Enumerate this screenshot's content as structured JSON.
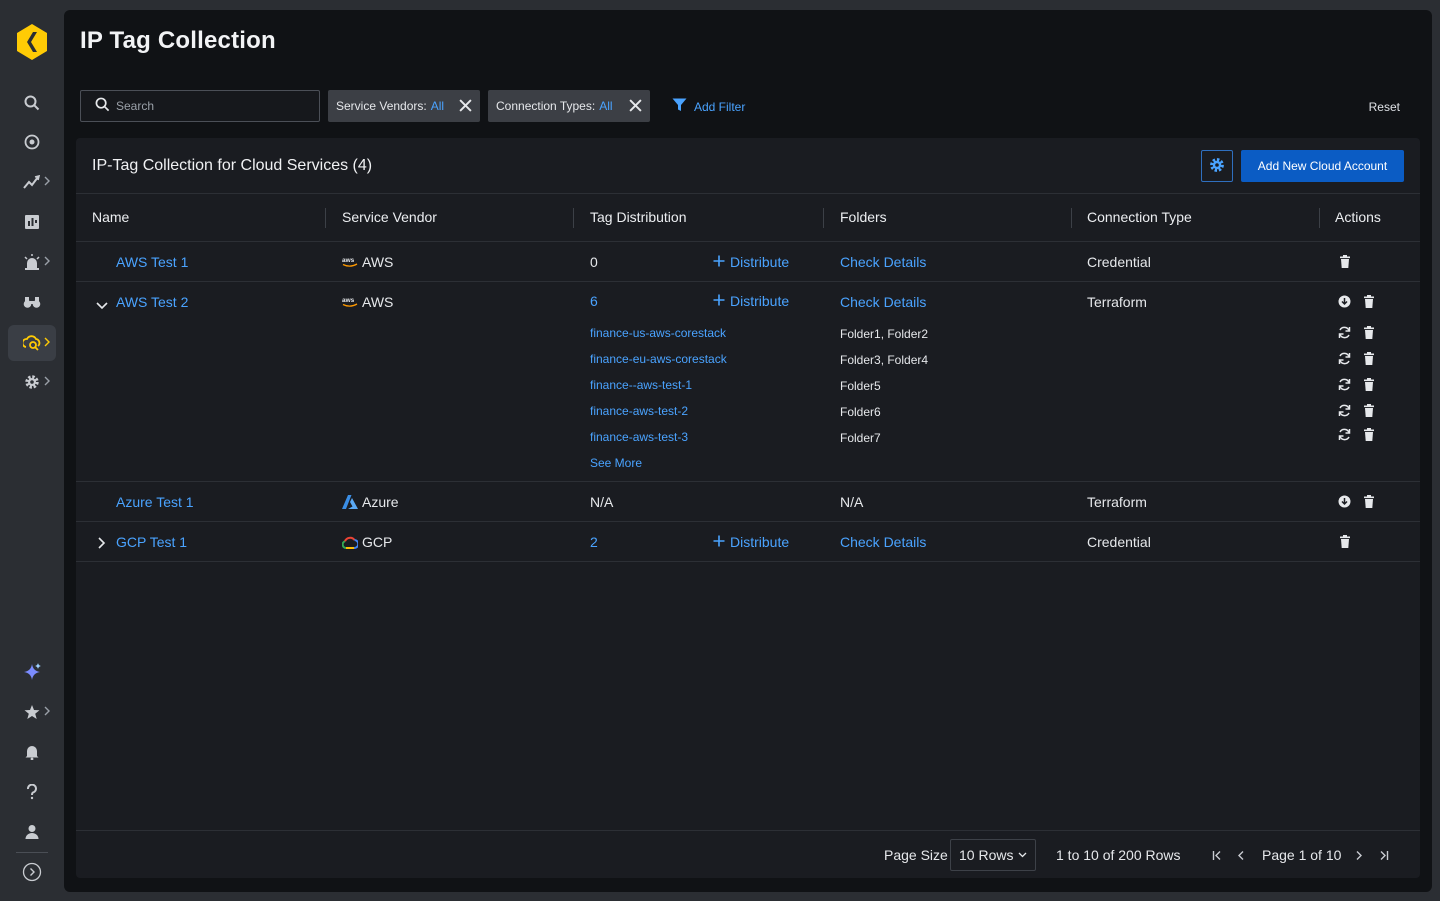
{
  "page": {
    "title": "IP Tag Collection"
  },
  "filters": {
    "search_placeholder": "Search",
    "chips": [
      {
        "label": "Service Vendors:",
        "value": "All"
      },
      {
        "label": "Connection Types:",
        "value": "All"
      }
    ],
    "add_filter_label": "Add Filter",
    "reset_label": "Reset"
  },
  "card": {
    "title": "IP-Tag Collection for Cloud Services (4)",
    "add_button_label": "Add New Cloud Account"
  },
  "columns": [
    "Name",
    "Service Vendor",
    "Tag Distribution",
    "Folders",
    "Connection Type",
    "Actions"
  ],
  "rows": [
    {
      "name": "AWS Test 1",
      "vendor": "AWS",
      "vendor_icon": "aws-logo-icon",
      "tag_count": "0",
      "distribute_label": "Distribute",
      "folders": "Check Details",
      "connection_type": "Credential"
    },
    {
      "name": "AWS Test 2",
      "vendor": "AWS",
      "vendor_icon": "aws-logo-icon",
      "tag_count": "6",
      "distribute_label": "Distribute",
      "folders": "Check Details",
      "connection_type": "Terraform",
      "sub_items": [
        {
          "tag": "finance-us-aws-corestack",
          "folders": "Folder1, Folder2"
        },
        {
          "tag": "finance-eu-aws-corestack",
          "folders": "Folder3, Folder4"
        },
        {
          "tag": "finance--aws-test-1",
          "folders": "Folder5"
        },
        {
          "tag": "finance-aws-test-2",
          "folders": "Folder6"
        },
        {
          "tag": "finance-aws-test-3",
          "folders": "Folder7"
        }
      ],
      "see_more_label": "See More"
    },
    {
      "name": "Azure Test 1",
      "vendor": "Azure",
      "vendor_icon": "azure-logo-icon",
      "tag_count": "N/A",
      "folders": "N/A",
      "connection_type": "Terraform"
    },
    {
      "name": "GCP Test 1",
      "vendor": "GCP",
      "vendor_icon": "gcp-logo-icon",
      "tag_count": "2",
      "distribute_label": "Distribute",
      "folders": "Check Details",
      "connection_type": "Credential"
    }
  ],
  "pagination": {
    "page_size_label": "Page Size",
    "page_size_value": "10 Rows",
    "rows_info": "1 to 10 of 200 Rows",
    "page_info": "Page 1 of 10"
  },
  "colors": {
    "accent": "#4aa3ff",
    "primary_button": "#0b5cc4",
    "logo": "#ffcb05",
    "rail_bg": "#2b2e33",
    "panel_bg": "#101215",
    "card_bg": "#1a1c21"
  },
  "icons": {
    "rail": [
      "logo-icon",
      "search-icon",
      "radar-icon",
      "activity-icon",
      "dashboard-icon",
      "alert-icon",
      "binoculars-icon",
      "cloud-search-icon",
      "settings-icon",
      "sparkle-icon",
      "star-icon",
      "bell-icon",
      "help-icon",
      "user-icon",
      "expand-icon"
    ]
  }
}
